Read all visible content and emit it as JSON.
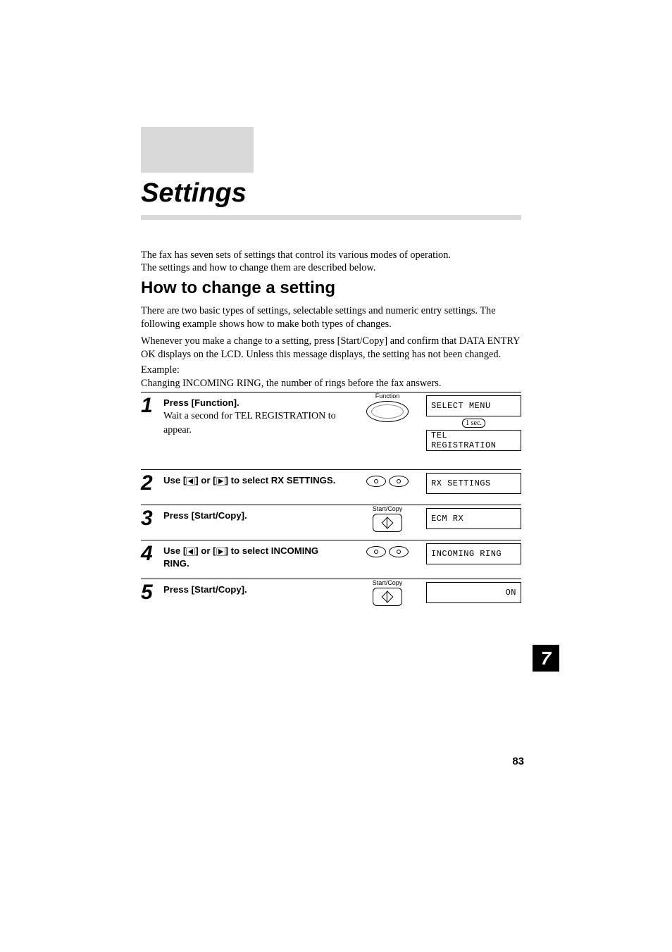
{
  "title": "Settings",
  "intro": {
    "line1": "The fax has seven sets of settings that control its various modes of operation.",
    "line2": "The settings and how to change them are described below."
  },
  "section_heading": "How to change a setting",
  "para_types": "There are two basic types of settings, selectable settings and numeric entry settings. The following example shows how to make both types of changes.",
  "para_confirm": "Whenever you make a change to a setting, press [Start/Copy] and confirm that DATA ENTRY OK displays on the LCD. Unless this message displays, the setting has not been changed.",
  "example_label": "Example:",
  "example_desc": "Changing INCOMING RING, the number of rings before the fax answers.",
  "steps": [
    {
      "num": "1",
      "bold": "Press [Function].",
      "rest": "Wait a second for TEL REGISTRATION to appear.",
      "control_label": "Function",
      "control_type": "function",
      "lcds": [
        "SELECT MENU",
        "TEL REGISTRATION"
      ],
      "lcd_note": "1 sec."
    },
    {
      "num": "2",
      "prefix": "Use [",
      "mid": "] or [",
      "suffix": "] to select RX SETTINGS.",
      "control_type": "arrows",
      "lcds": [
        "RX SETTINGS"
      ]
    },
    {
      "num": "3",
      "bold": "Press [Start/Copy].",
      "control_label": "Start/Copy",
      "control_type": "startcopy",
      "lcds": [
        "ECM RX"
      ]
    },
    {
      "num": "4",
      "prefix": "Use [",
      "mid": "] or [",
      "suffix": "] to select INCOMING RING.",
      "control_type": "arrows",
      "lcds": [
        "INCOMING RING"
      ]
    },
    {
      "num": "5",
      "bold": "Press [Start/Copy].",
      "control_label": "Start/Copy",
      "control_type": "startcopy",
      "lcds_right": [
        "ON"
      ]
    }
  ],
  "chapter_tab": "7",
  "page_number": "83"
}
